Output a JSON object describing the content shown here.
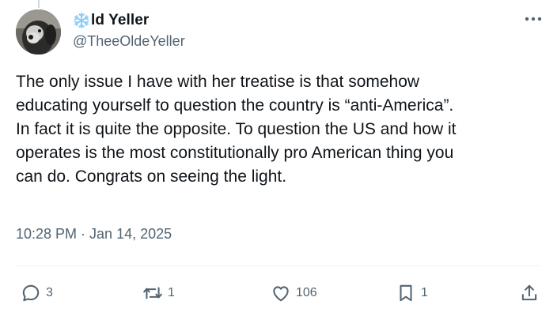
{
  "author": {
    "name": "ld Yeller",
    "handle": "@TheeOldeYeller",
    "name_emoji": "snowflake-icon"
  },
  "tweet": {
    "lines": [
      "The only issue I have with her treatise is that somehow",
      "educating yourself to question the country is “anti-America”.",
      "In fact it is quite the opposite. To question the US and how it",
      "operates is the most constitutionally pro American thing you",
      "can do. Congrats on seeing the light."
    ],
    "time": "10:28 PM",
    "separator": "·",
    "date": "Jan 14, 2025"
  },
  "actions": {
    "replies": "3",
    "reposts": "1",
    "likes": "106",
    "bookmarks": "1"
  },
  "colors": {
    "text": "#0f1419",
    "secondary": "#536471",
    "snowflake": "#8ecdf5"
  }
}
